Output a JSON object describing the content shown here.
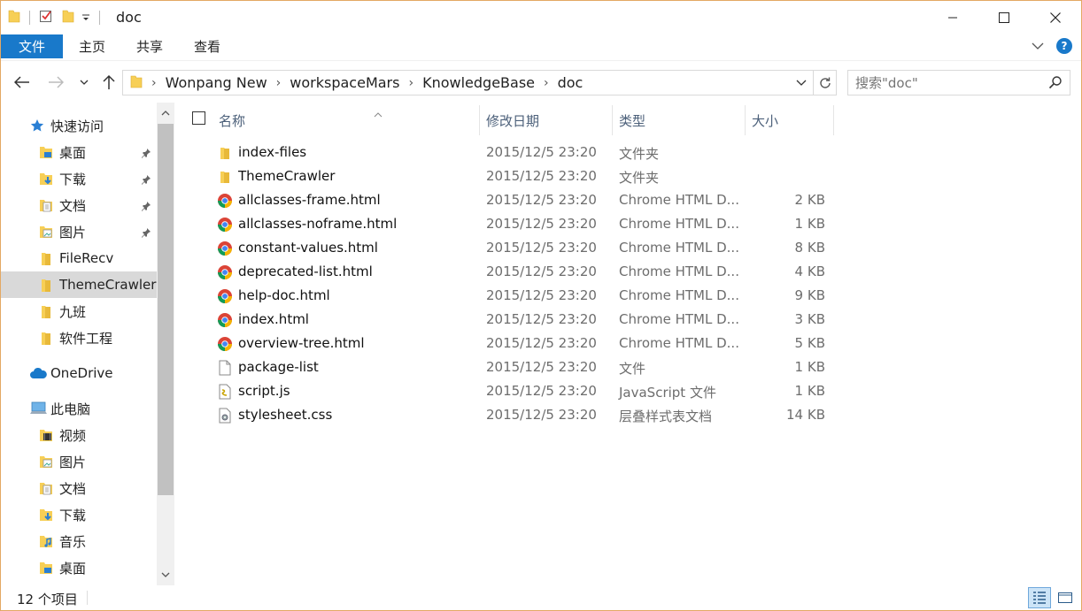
{
  "window": {
    "title": "doc"
  },
  "ribbon": {
    "file": "文件",
    "tabs": [
      "主页",
      "共享",
      "查看"
    ]
  },
  "address": {
    "crumbs": [
      "Wonpang New",
      "workspaceMars",
      "KnowledgeBase",
      "doc"
    ]
  },
  "search": {
    "placeholder": "搜索\"doc\""
  },
  "nav": {
    "quick_access": "快速访问",
    "quick_items": [
      "桌面",
      "下载",
      "文档",
      "图片",
      "FileRecv",
      "ThemeCrawler",
      "九班",
      "软件工程"
    ],
    "onedrive": "OneDrive",
    "this_pc": "此电脑",
    "pc_items": [
      "视频",
      "图片",
      "文档",
      "下载",
      "音乐",
      "桌面"
    ]
  },
  "columns": {
    "name": "名称",
    "date": "修改日期",
    "type": "类型",
    "size": "大小"
  },
  "files": [
    {
      "name": "index-files",
      "date": "2015/12/5 23:20",
      "type": "文件夹",
      "size": "",
      "icon": "folder-icon"
    },
    {
      "name": "ThemeCrawler",
      "date": "2015/12/5 23:20",
      "type": "文件夹",
      "size": "",
      "icon": "folder-icon"
    },
    {
      "name": "allclasses-frame.html",
      "date": "2015/12/5 23:20",
      "type": "Chrome HTML D...",
      "size": "2 KB",
      "icon": "chrome-icon"
    },
    {
      "name": "allclasses-noframe.html",
      "date": "2015/12/5 23:20",
      "type": "Chrome HTML D...",
      "size": "1 KB",
      "icon": "chrome-icon"
    },
    {
      "name": "constant-values.html",
      "date": "2015/12/5 23:20",
      "type": "Chrome HTML D...",
      "size": "8 KB",
      "icon": "chrome-icon"
    },
    {
      "name": "deprecated-list.html",
      "date": "2015/12/5 23:20",
      "type": "Chrome HTML D...",
      "size": "4 KB",
      "icon": "chrome-icon"
    },
    {
      "name": "help-doc.html",
      "date": "2015/12/5 23:20",
      "type": "Chrome HTML D...",
      "size": "9 KB",
      "icon": "chrome-icon"
    },
    {
      "name": "index.html",
      "date": "2015/12/5 23:20",
      "type": "Chrome HTML D...",
      "size": "3 KB",
      "icon": "chrome-icon"
    },
    {
      "name": "overview-tree.html",
      "date": "2015/12/5 23:20",
      "type": "Chrome HTML D...",
      "size": "5 KB",
      "icon": "chrome-icon"
    },
    {
      "name": "package-list",
      "date": "2015/12/5 23:20",
      "type": "文件",
      "size": "1 KB",
      "icon": "blank-file-icon"
    },
    {
      "name": "script.js",
      "date": "2015/12/5 23:20",
      "type": "JavaScript 文件",
      "size": "1 KB",
      "icon": "script-file-icon"
    },
    {
      "name": "stylesheet.css",
      "date": "2015/12/5 23:20",
      "type": "层叠样式表文档",
      "size": "14 KB",
      "icon": "css-file-icon"
    }
  ],
  "status": {
    "count": "12 个项目"
  },
  "colors": {
    "accent": "#1979ca",
    "folder": "#f7cf56",
    "selected_bg": "#d9d9d9",
    "window_border": "#e3a864"
  }
}
